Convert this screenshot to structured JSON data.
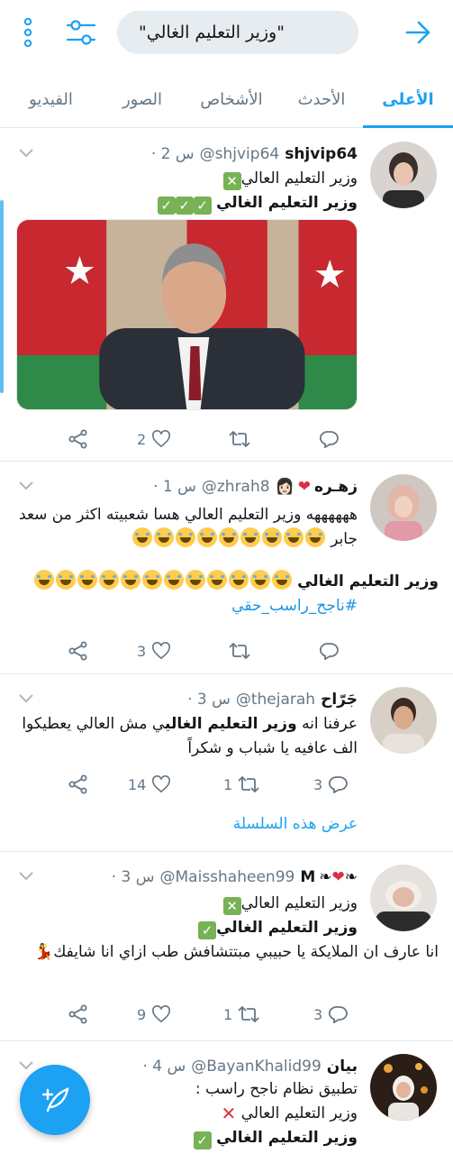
{
  "search": {
    "query": "\"وزير التعليم الغالي\""
  },
  "tabs": [
    "الأعلى",
    "الأحدث",
    "الأشخاص",
    "الصور",
    "الفيديو"
  ],
  "colors": {
    "accent": "#1da1f2",
    "text": "#14171a",
    "secondary": "#657786"
  },
  "icons": [
    "back-arrow-icon",
    "filter-sliders-icon",
    "more-vertical-icon",
    "chevron-down-icon",
    "reply-icon",
    "retweet-icon",
    "like-icon",
    "share-icon",
    "compose-icon"
  ],
  "tweets": [
    {
      "name": "shjvip64",
      "handle": "@shjvip64",
      "time": "· 2 س",
      "lines": [
        "وزير التعليم العالي",
        "وزير التعليم الغالي"
      ],
      "likes": "2",
      "retweets": "",
      "replies": ""
    },
    {
      "name": "زهـره",
      "handle": "@zhrah8",
      "time": "· 1 س",
      "lines": [
        "ههههههه وزير التعليم العالي هسا شعبيته اكثر من سعد جابر",
        "وزير التعليم الغالي",
        "#ناجح_راسب_حقي"
      ],
      "likes": "3",
      "retweets": "",
      "replies": ""
    },
    {
      "name": "جَرّاح",
      "handle": "@thejarah",
      "time": "· 3 س",
      "lines": [
        "عرفنا انه",
        "وزير التعليم الغالي",
        "ي مش العالي يعطيكوا الف عافيه يا شباب و شكراً"
      ],
      "likes": "14",
      "retweets": "1",
      "replies": "3",
      "thread_link": "عرض هذه السلسلة"
    },
    {
      "name": "M",
      "handle": "@Maisshaheen99",
      "time": "· 3 س",
      "lines": [
        "وزير التعليم العالي",
        "وزير التعليم الغالي",
        "انا عارف ان الملايكة يا حبيبي مبتتشافش طب ازاي انا شايفك"
      ],
      "likes": "9",
      "retweets": "1",
      "replies": "3"
    },
    {
      "name": "بيان",
      "handle": "@BayanKhalid99",
      "time": "· 4 س",
      "lines": [
        "تطبيق نظام ناجح راسب :",
        "وزير التعليم العالي",
        "وزير التعليم الغالي"
      ]
    }
  ]
}
